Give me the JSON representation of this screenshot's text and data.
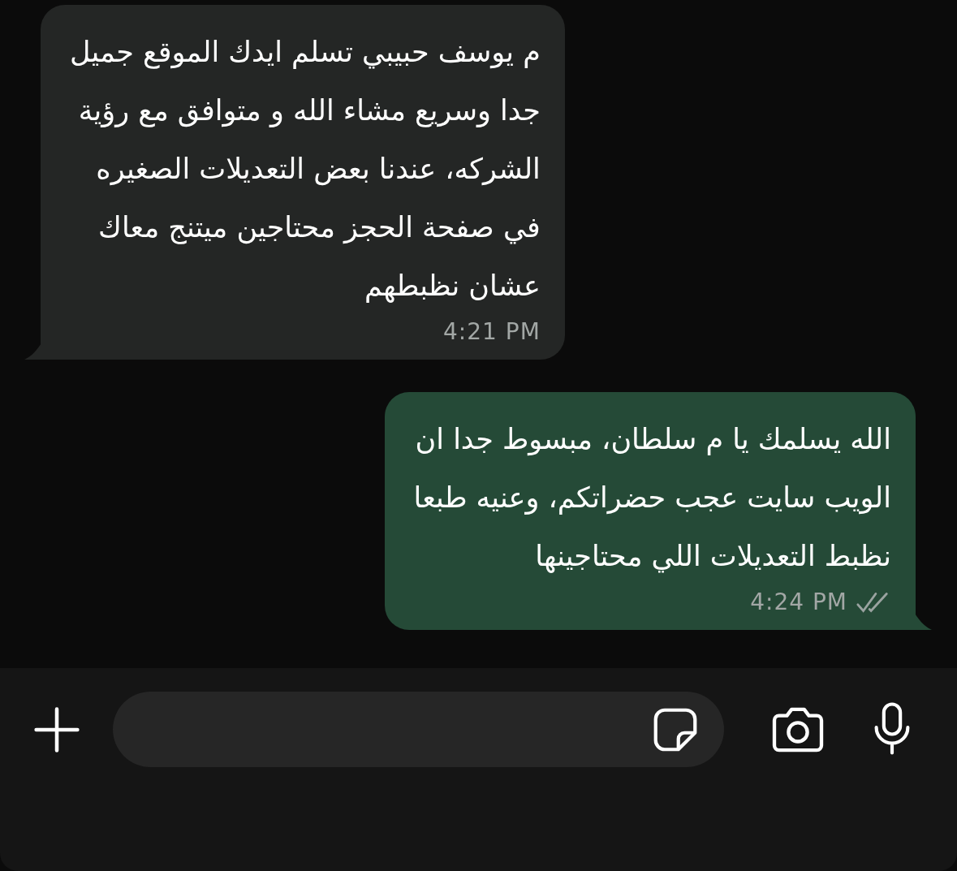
{
  "messages": [
    {
      "outgoing": false,
      "text": "م يوسف حبيبي تسلم ايدك الموقع جميل\nجدا وسريع مشاء الله و متوافق مع رؤية\nالشركه، عندنا بعض التعديلات الصغيره\nفي صفحة الحجز محتاجين ميتنج معاك\nعشان نظبطهم",
      "time": "4:21 PM"
    },
    {
      "outgoing": true,
      "text": "الله يسلمك يا م سلطان، مبسوط جدا ان\nالويب سايت عجب حضراتكم، وعنيه طبعا\nنظبط التعديلات اللي محتاجينها",
      "time": "4:24 PM",
      "read": false
    }
  ]
}
